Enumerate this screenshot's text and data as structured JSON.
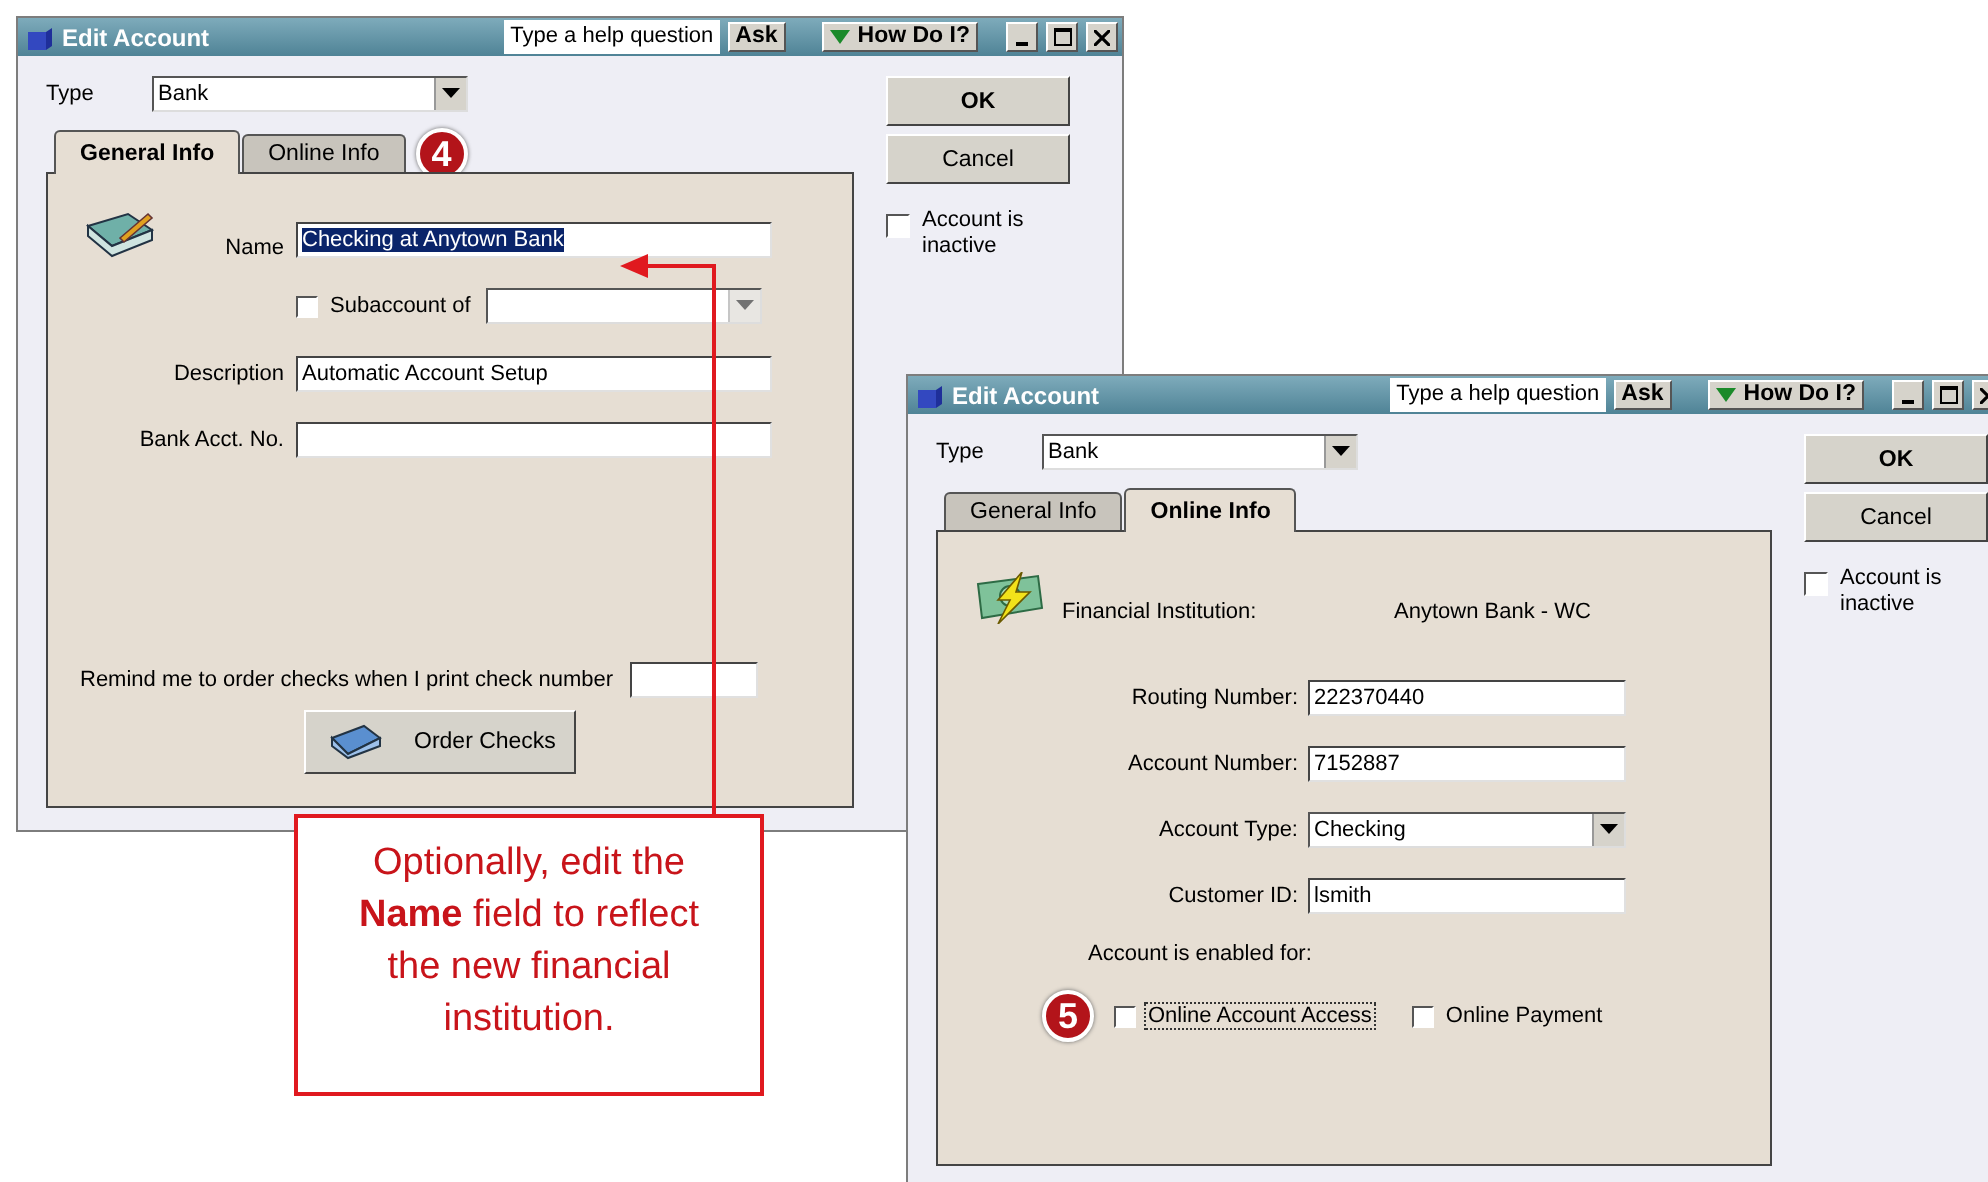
{
  "windows": [
    {
      "title": "Edit Account",
      "help_placeholder": "Type a help question",
      "ask": "Ask",
      "how_do_i": "How Do I?",
      "type_label": "Type",
      "type_value": "Bank",
      "tabs": [
        {
          "label": "General Info",
          "selected": true
        },
        {
          "label": "Online Info",
          "selected": false
        }
      ],
      "step": "4",
      "buttons": [
        "OK",
        "Cancel"
      ],
      "inactive": {
        "label": "Account is inactive",
        "checked": false
      },
      "panel": {
        "kind": "general",
        "name": {
          "label": "Name",
          "value": "Checking at Anytown Bank",
          "highlighted": true
        },
        "subaccount": {
          "label": "Subaccount of",
          "checked": false
        },
        "description": {
          "label": "Description",
          "value": "Automatic Account Setup"
        },
        "bank_acct": {
          "label": "Bank Acct. No."
        },
        "remind": {
          "label": "Remind me to order checks when I print check number"
        },
        "order_button": "Order Checks"
      }
    },
    {
      "title": "Edit Account",
      "help_placeholder": "Type a help question",
      "ask": "Ask",
      "how_do_i": "How Do I?",
      "type_label": "Type",
      "type_value": "Bank",
      "tabs": [
        {
          "label": "General Info",
          "selected": false
        },
        {
          "label": "Online Info",
          "selected": true
        }
      ],
      "buttons": [
        "OK",
        "Cancel"
      ],
      "inactive": {
        "label": "Account is inactive",
        "checked": false
      },
      "panel": {
        "kind": "online",
        "institution_label": "Financial Institution:",
        "institution_value": "Anytown Bank - WC",
        "fields": [
          {
            "label": "Routing Number:",
            "value": "222370440",
            "kind": "text"
          },
          {
            "label": "Account Number:",
            "value": "7152887",
            "kind": "text"
          },
          {
            "label": "Account Type:",
            "value": "Checking",
            "kind": "dropdown"
          },
          {
            "label": "Customer ID:",
            "value": "lsmith",
            "kind": "text"
          }
        ],
        "enabled_label": "Account is enabled for:",
        "step": "5",
        "options": [
          {
            "label": "Online Account Access",
            "checked": false,
            "focused": true
          },
          {
            "label": "Online Payment",
            "checked": false,
            "focused": false
          }
        ]
      }
    }
  ],
  "callout": "Optionally, edit the **Name** field to reflect the new financial institution."
}
